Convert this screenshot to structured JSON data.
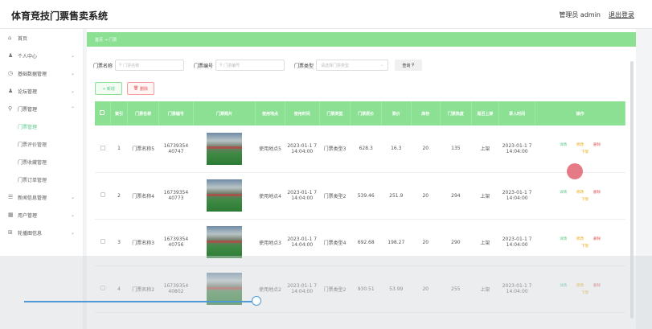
{
  "app": {
    "title": "体育竞技门票售卖系统",
    "admin_label": "管理员 admin",
    "logout": "退出登录"
  },
  "sidebar": {
    "items": [
      {
        "icon": "home-icon",
        "glyph": "⌂",
        "label": "首页",
        "chevron": ""
      },
      {
        "icon": "user-icon",
        "glyph": "♟",
        "label": "个人中心",
        "chevron": "⌄"
      },
      {
        "icon": "clock-icon",
        "glyph": "◷",
        "label": "基础数据管理",
        "chevron": "⌄"
      },
      {
        "icon": "forum-icon",
        "glyph": "♟",
        "label": "论坛管理",
        "chevron": "⌄"
      },
      {
        "icon": "ticket-icon",
        "glyph": "⚲",
        "label": "门票管理",
        "chevron": "⌃"
      }
    ],
    "subitems": [
      {
        "label": "门票管理",
        "active": true
      },
      {
        "label": "门票评价管理",
        "active": false
      },
      {
        "label": "门票收藏管理",
        "active": false
      },
      {
        "label": "门票订单管理",
        "active": false
      }
    ],
    "more": [
      {
        "icon": "news-icon",
        "glyph": "☰",
        "label": "新闻信息管理",
        "chevron": "⌄"
      },
      {
        "icon": "users-icon",
        "glyph": "▦",
        "label": "用户管理",
        "chevron": "⌄"
      },
      {
        "icon": "carousel-icon",
        "glyph": "⊞",
        "label": "轮播图信息",
        "chevron": "⌄"
      }
    ]
  },
  "breadcrumb": "首页 → 门票",
  "filters": {
    "name_label": "门票名称",
    "name_placeholder": "门票名称",
    "code_label": "门票编号",
    "code_placeholder": "门票编号",
    "type_label": "门票类型",
    "type_placeholder": "请选择门票类型",
    "search_label": "查询"
  },
  "buttons": {
    "add": "+ 新增",
    "delete": "删除"
  },
  "table": {
    "headers": [
      "索引",
      "门票名称",
      "门票编号",
      "门票照片",
      "使用地点",
      "使用时间",
      "门票类型",
      "门票原价",
      "票价",
      "库存",
      "门票热度",
      "是否上架",
      "录入时间",
      "操作"
    ],
    "rows": [
      {
        "index": "1",
        "name": "门票名称5",
        "code": "16739354 40747",
        "place": "使用地点5",
        "time": "2023-01-1 7 14:04:00",
        "type": "门票类型3",
        "orig": "628.3",
        "price": "16.3",
        "stock": "20",
        "heat": "135",
        "onsale": "上架",
        "created": "2023-01-1 7 14:04:00"
      },
      {
        "index": "2",
        "name": "门票名称4",
        "code": "16739354 40773",
        "place": "使用地点4",
        "time": "2023-01-1 7 14:04:00",
        "type": "门票类型2",
        "orig": "539.46",
        "price": "251.9",
        "stock": "20",
        "heat": "294",
        "onsale": "上架",
        "created": "2023-01-1 7 14:04:00"
      },
      {
        "index": "3",
        "name": "门票名称3",
        "code": "16739354 40756",
        "place": "使用地点3",
        "time": "2023-01-1 7 14:04:00",
        "type": "门票类型4",
        "orig": "692.68",
        "price": "198.27",
        "stock": "20",
        "heat": "290",
        "onsale": "上架",
        "created": "2023-01-1 7 14:04:00"
      },
      {
        "index": "4",
        "name": "门票名称2",
        "code": "16739354 40802",
        "place": "使用地点2",
        "time": "2023-01-1 7 14:04:00",
        "type": "门票类型2",
        "orig": "930.51",
        "price": "53.99",
        "stock": "20",
        "heat": "255",
        "onsale": "上架",
        "created": "2023-01-1 7 14:04:00"
      }
    ],
    "ops": {
      "detail": "详情",
      "edit": "修改",
      "remove": "删除",
      "offsale": "下架"
    }
  }
}
